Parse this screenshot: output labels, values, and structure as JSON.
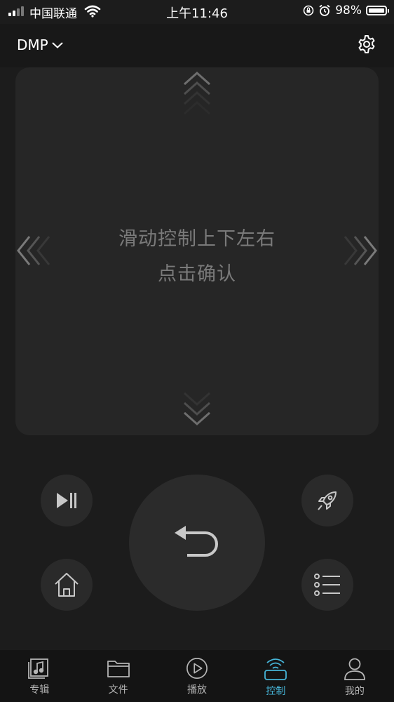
{
  "status_bar": {
    "carrier": "中国联通",
    "time": "上午11:46",
    "battery": "98%",
    "battery_level": 0.98
  },
  "header": {
    "device_name": "DMP",
    "dropdown_icon": "chevron-down-icon",
    "settings_icon": "gear-icon"
  },
  "touchpad": {
    "hint_line1": "滑动控制上下左右",
    "hint_line2": "点击确认"
  },
  "controls": {
    "play_pause_icon": "play-pause-icon",
    "back_icon": "back-arrow-icon",
    "rocket_icon": "rocket-icon",
    "home_icon": "home-icon",
    "menu_icon": "list-menu-icon"
  },
  "tabs": [
    {
      "label": "专辑",
      "icon": "album-icon",
      "active": false
    },
    {
      "label": "文件",
      "icon": "folder-icon",
      "active": false
    },
    {
      "label": "播放",
      "icon": "play-circle-icon",
      "active": false
    },
    {
      "label": "控制",
      "icon": "remote-control-icon",
      "active": true
    },
    {
      "label": "我的",
      "icon": "user-icon",
      "active": false
    }
  ],
  "colors": {
    "background": "#1c1c1c",
    "accent": "#46b5d8",
    "hint_text": "#7a7a7a"
  }
}
